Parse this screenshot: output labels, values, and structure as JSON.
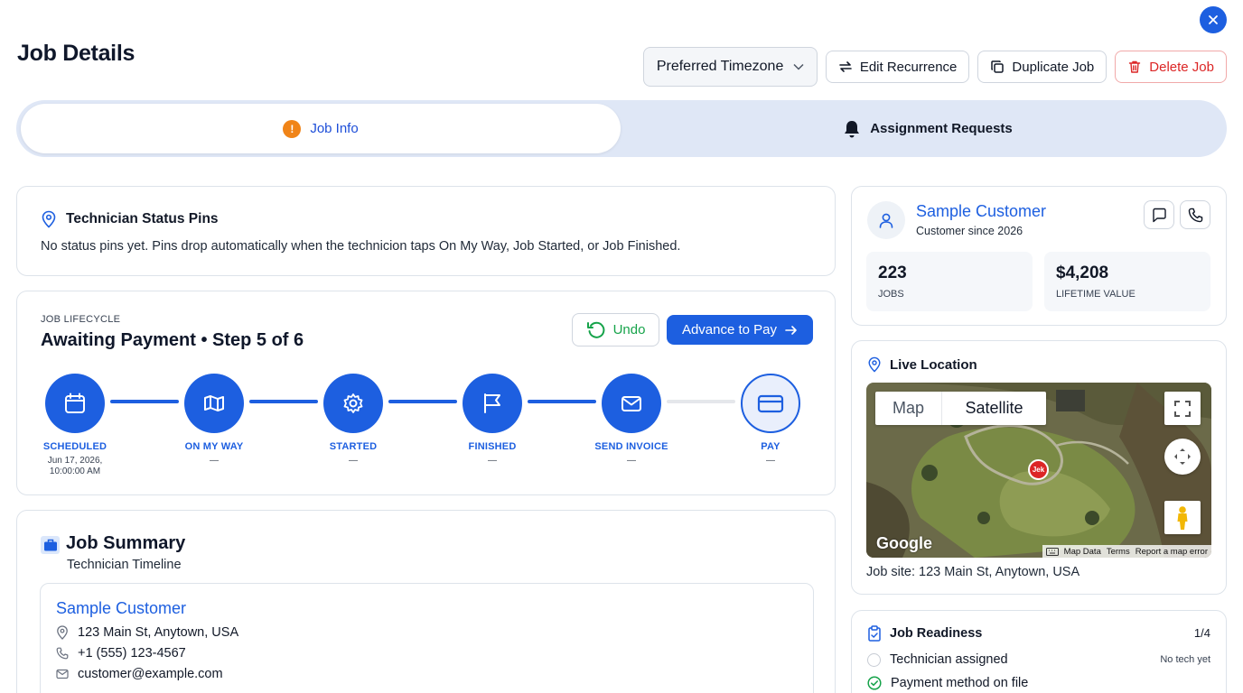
{
  "header": {
    "title": "Job Details",
    "timezone_label": "Preferred Timezone",
    "edit_recurrence": "Edit Recurrence",
    "duplicate_job": "Duplicate Job",
    "delete_job": "Delete Job"
  },
  "tabs": [
    {
      "label": "Job Info",
      "badge": "!"
    },
    {
      "label": "Assignment Requests"
    }
  ],
  "status_pins": {
    "title": "Technician Status Pins",
    "message": "No status pins yet. Pins drop automatically when the technicion taps On My Way, Job Started, or Job Finished."
  },
  "lifecycle": {
    "eyebrow": "JOB LIFECYCLE",
    "title": "Awaiting Payment • Step 5 of 6",
    "undo": "Undo",
    "advance": "Advance to Pay",
    "steps": [
      {
        "label": "SCHEDULED",
        "sub": "Jun 17, 2026,",
        "sub2": "10:00:00 AM"
      },
      {
        "label": "ON MY WAY",
        "sub": "—"
      },
      {
        "label": "STARTED",
        "sub": "—"
      },
      {
        "label": "FINISHED",
        "sub": "—"
      },
      {
        "label": "SEND INVOICE",
        "sub": "—"
      },
      {
        "label": "PAY",
        "sub": "—"
      }
    ]
  },
  "summary": {
    "title": "Job Summary",
    "subtitle": "Technician Timeline",
    "customer_name": "Sample Customer",
    "address": "123 Main St, Anytown, USA",
    "phone": "+1 (555) 123-4567",
    "email": "customer@example.com"
  },
  "customer": {
    "name": "Sample Customer",
    "since": "Customer since 2026",
    "jobs_value": "223",
    "jobs_label": "JOBS",
    "lifetime_value": "$4,208",
    "lifetime_label": "LIFETIME VALUE"
  },
  "location": {
    "title": "Live Location",
    "map_tab": "Map",
    "satellite_tab": "Satellite",
    "marker": "Jek",
    "google": "Google",
    "map_data": "Map Data",
    "terms": "Terms",
    "report": "Report a map error",
    "job_site": "Job site: 123 Main St, Anytown, USA"
  },
  "readiness": {
    "title": "Job Readiness",
    "count": "1/4",
    "items": [
      {
        "label": "Technician assigned",
        "note": "No tech yet"
      },
      {
        "label": "Payment method on file",
        "note": ""
      }
    ]
  },
  "colors": {
    "accent": "#1d5fe0",
    "danger": "#dc2626",
    "success": "#16a34a"
  }
}
